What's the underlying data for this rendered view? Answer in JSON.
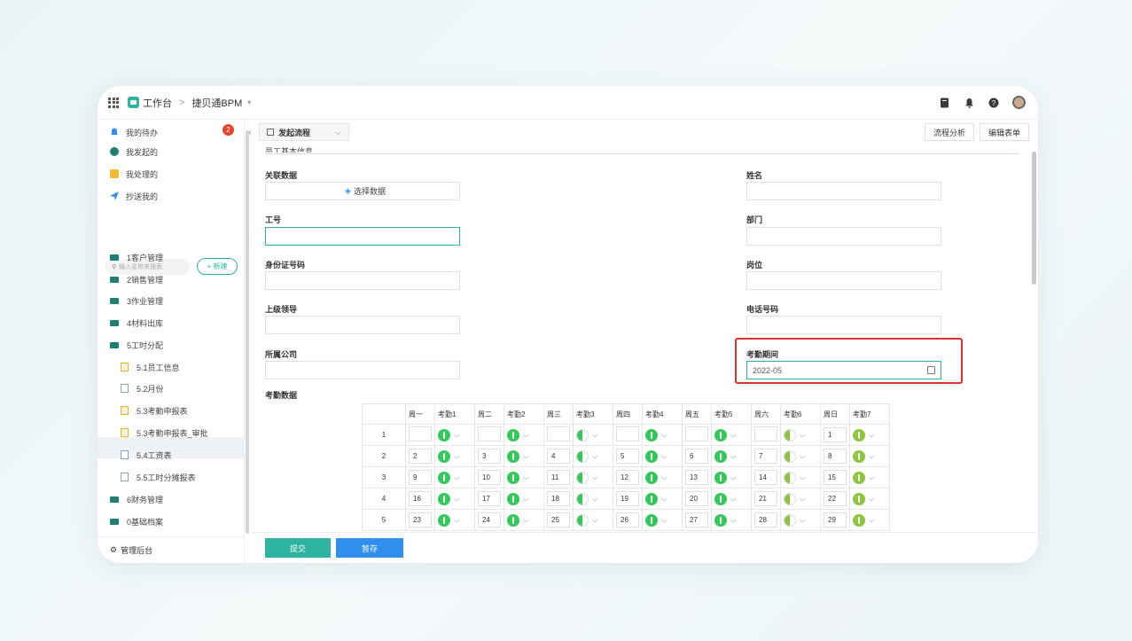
{
  "topbar": {
    "workspace": "工作台",
    "separator": ">",
    "app_name": "捷贝通BPM",
    "caret": "▾"
  },
  "sidebar": {
    "quick": [
      {
        "label": "我的待办",
        "badge": "2"
      },
      {
        "label": "我发起的"
      },
      {
        "label": "我处理的"
      },
      {
        "label": "抄送我的"
      }
    ],
    "search_placeholder": "输入名称来搜索",
    "new_button": "+ 新建",
    "tree": [
      {
        "label": "1客户管理",
        "type": "folder"
      },
      {
        "label": "2销售管理",
        "type": "folder"
      },
      {
        "label": "3作业管理",
        "type": "folder"
      },
      {
        "label": "4材料出库",
        "type": "folder"
      },
      {
        "label": "5工时分配",
        "type": "folder"
      },
      {
        "label": "5.1员工信息",
        "type": "doc"
      },
      {
        "label": "5.2月份",
        "type": "doc"
      },
      {
        "label": "5.3考勤申报表",
        "type": "doc",
        "active": true
      },
      {
        "label": "5.3考勤申报表_审批",
        "type": "doc"
      },
      {
        "label": "5.4工资表",
        "type": "doc"
      },
      {
        "label": "5.5工时分摊报表",
        "type": "doc"
      },
      {
        "label": "6财务管理",
        "type": "folder"
      },
      {
        "label": "0基础档案",
        "type": "folder"
      }
    ],
    "admin": "管理后台",
    "collapse": "«"
  },
  "main": {
    "tab_label": "发起流程",
    "tab_chevron": "⌵",
    "flow_analysis": "流程分析",
    "edit_form": "编辑表单",
    "section_title": "员工基本信息",
    "fields": {
      "related_label": "关联数据",
      "related_button": "选择数据",
      "name_label": "姓名",
      "employee_id_label": "工号",
      "department_label": "部门",
      "id_card_label": "身份证号码",
      "position_label": "岗位",
      "supervisor_label": "上级领导",
      "phone_label": "电话号码",
      "company_label": "所属公司",
      "period_label": "考勤期间",
      "period_value": "2022-05"
    },
    "attendance": {
      "title": "考勤数据",
      "headers": [
        "",
        "周一",
        "考勤1",
        "周二",
        "考勤2",
        "周三",
        "考勤3",
        "周四",
        "考勤4",
        "周五",
        "考勤5",
        "周六",
        "考勤6",
        "周日",
        "考勤7"
      ],
      "rows": [
        {
          "n": "1",
          "days": [
            "",
            "",
            "",
            "",
            "",
            "",
            "1"
          ],
          "marks": [
            "g",
            "g",
            "half",
            "g",
            "g",
            "half-y",
            "y"
          ]
        },
        {
          "n": "2",
          "days": [
            "2",
            "3",
            "4",
            "5",
            "6",
            "7",
            "8"
          ],
          "marks": [
            "g",
            "g",
            "half",
            "g",
            "g",
            "half-y",
            "y"
          ]
        },
        {
          "n": "3",
          "days": [
            "9",
            "10",
            "11",
            "12",
            "13",
            "14",
            "15"
          ],
          "marks": [
            "g",
            "g",
            "half",
            "g",
            "g",
            "half-y",
            "y"
          ]
        },
        {
          "n": "4",
          "days": [
            "16",
            "17",
            "18",
            "19",
            "20",
            "21",
            "22"
          ],
          "marks": [
            "g",
            "g",
            "half",
            "g",
            "g",
            "half-y",
            "y"
          ]
        },
        {
          "n": "5",
          "days": [
            "23",
            "24",
            "25",
            "26",
            "27",
            "28",
            "29"
          ],
          "marks": [
            "g",
            "g",
            "half",
            "g",
            "g",
            "half-y",
            "y"
          ]
        }
      ]
    },
    "submit": "提交",
    "save_draft": "暂存"
  },
  "colors": {
    "accent": "#2eb39e",
    "primary_blue": "#2f8fef",
    "badge_red": "#e8452f",
    "highlight_red": "#e03131",
    "green": "#34c759"
  }
}
